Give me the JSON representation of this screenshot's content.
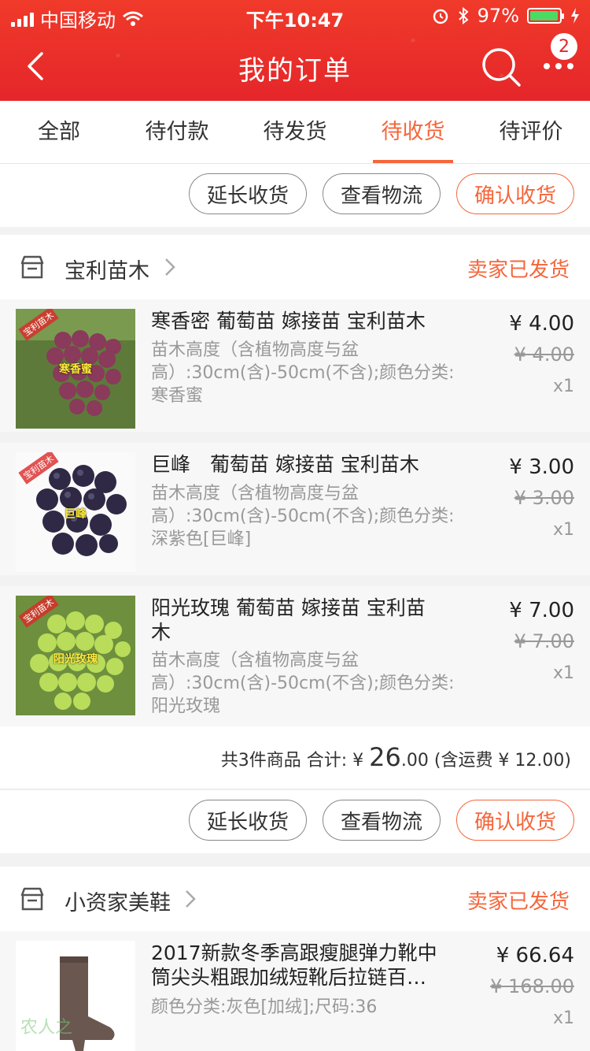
{
  "status_bar": {
    "carrier": "中国移动",
    "time": "下午10:47",
    "battery_percent": "97%",
    "battery_level": 0.97
  },
  "nav": {
    "title": "我的订单",
    "more_badge": "2"
  },
  "tabs": [
    {
      "label": "全部",
      "active": false
    },
    {
      "label": "待付款",
      "active": false
    },
    {
      "label": "待发货",
      "active": false
    },
    {
      "label": "待收货",
      "active": true
    },
    {
      "label": "待评价",
      "active": false
    }
  ],
  "actions": {
    "extend": "延长收货",
    "logistics": "查看物流",
    "confirm": "确认收货"
  },
  "orders": [
    {
      "shop": "宝利苗木",
      "status": "卖家已发货",
      "items": [
        {
          "thumb_label": "寒香蜜",
          "thumb_tag": "宝利苗木",
          "title": "寒香密 葡萄苗 嫁接苗 宝利苗木",
          "sku": "苗木高度（含植物高度与盆高）:30cm(含)-50cm(不含);颜色分类:寒香蜜",
          "price": "¥ 4.00",
          "orig_price": "¥ 4.00",
          "qty": "x1"
        },
        {
          "thumb_label": "巨峰",
          "thumb_tag": "宝利苗木",
          "title": "巨峰　葡萄苗 嫁接苗 宝利苗木",
          "sku": "苗木高度（含植物高度与盆高）:30cm(含)-50cm(不含);颜色分类:深紫色[巨峰]",
          "price": "¥ 3.00",
          "orig_price": "¥ 3.00",
          "qty": "x1"
        },
        {
          "thumb_label": "阳光玫瑰",
          "thumb_tag": "宝利苗木",
          "title": "阳光玫瑰 葡萄苗 嫁接苗 宝利苗木",
          "sku": "苗木高度（含植物高度与盆高）:30cm(含)-50cm(不含);颜色分类:阳光玫瑰",
          "price": "¥ 7.00",
          "orig_price": "¥ 7.00",
          "qty": "x1"
        }
      ],
      "summary": {
        "count_text": "共3件商品 合计: ¥",
        "total_int": "26",
        "total_dec": ".00",
        "shipping": "(含运费 ¥ 12.00)"
      }
    },
    {
      "shop": "小资家美鞋",
      "status": "卖家已发货",
      "items": [
        {
          "title": "2017新款冬季高跟瘦腿弹力靴中筒尖头粗跟加绒短靴后拉链百…",
          "sku": "颜色分类:灰色[加绒];尺码:36",
          "price": "¥ 66.64",
          "orig_price": "¥ 168.00",
          "qty": "x1"
        }
      ]
    }
  ],
  "colors": {
    "header": "#e5262a",
    "accent": "#f5663b",
    "battery": "#4cd964"
  },
  "watermark": "农人之"
}
